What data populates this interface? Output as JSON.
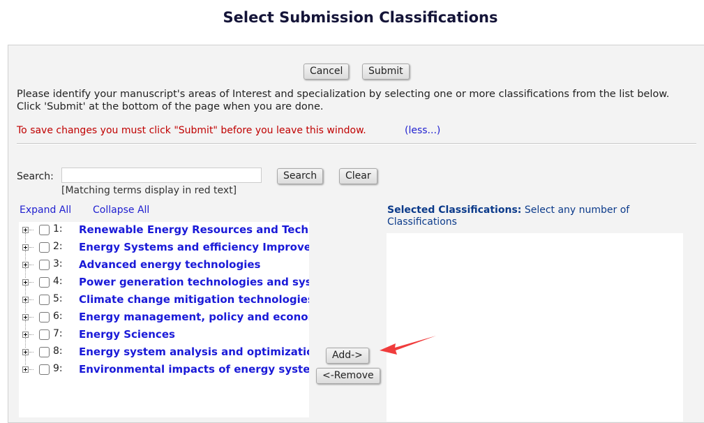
{
  "title": "Select Submission Classifications",
  "buttons": {
    "cancel": "Cancel",
    "submit": "Submit",
    "search": "Search",
    "clear": "Clear",
    "add": "Add->",
    "remove": "<-Remove"
  },
  "instructions": {
    "line1": "Please identify your manuscript's areas of Interest and specialization by selecting one or more classifications from the list below.",
    "line2": "Click 'Submit' at the bottom of the page when you are done.",
    "warning": "To save changes you must click \"Submit\" before you leave this window.",
    "less_link": "(less...)"
  },
  "search": {
    "label": "Search:",
    "value": "",
    "hint": "[Matching terms display in red text]"
  },
  "tree_controls": {
    "expand_all": "Expand All",
    "collapse_all": "Collapse All"
  },
  "classifications": [
    {
      "num": "1:",
      "label": "Renewable Energy Resources and Technologies",
      "checked": false
    },
    {
      "num": "2:",
      "label": "Energy Systems and efficiency Improvement",
      "checked": false
    },
    {
      "num": "3:",
      "label": "Advanced energy technologies",
      "checked": false
    },
    {
      "num": "4:",
      "label": "Power generation technologies and systems",
      "checked": false
    },
    {
      "num": "5:",
      "label": "Climate change mitigation technologies",
      "checked": false
    },
    {
      "num": "6:",
      "label": "Energy management, policy and economics",
      "checked": false
    },
    {
      "num": "7:",
      "label": "Energy Sciences",
      "checked": false
    },
    {
      "num": "8:",
      "label": "Energy system analysis and optimization",
      "checked": false
    },
    {
      "num": "9:",
      "label": "Environmental impacts of energy systems",
      "checked": false
    }
  ],
  "selected": {
    "heading": "Selected Classifications:",
    "subheading": "Select any number of Classifications",
    "items": []
  },
  "colors": {
    "warning": "#c00000",
    "link": "#2020d0",
    "classification": "#1a1ad8",
    "selected_heading": "#0b3a8a",
    "annotation_arrow": "#f03c3c"
  }
}
